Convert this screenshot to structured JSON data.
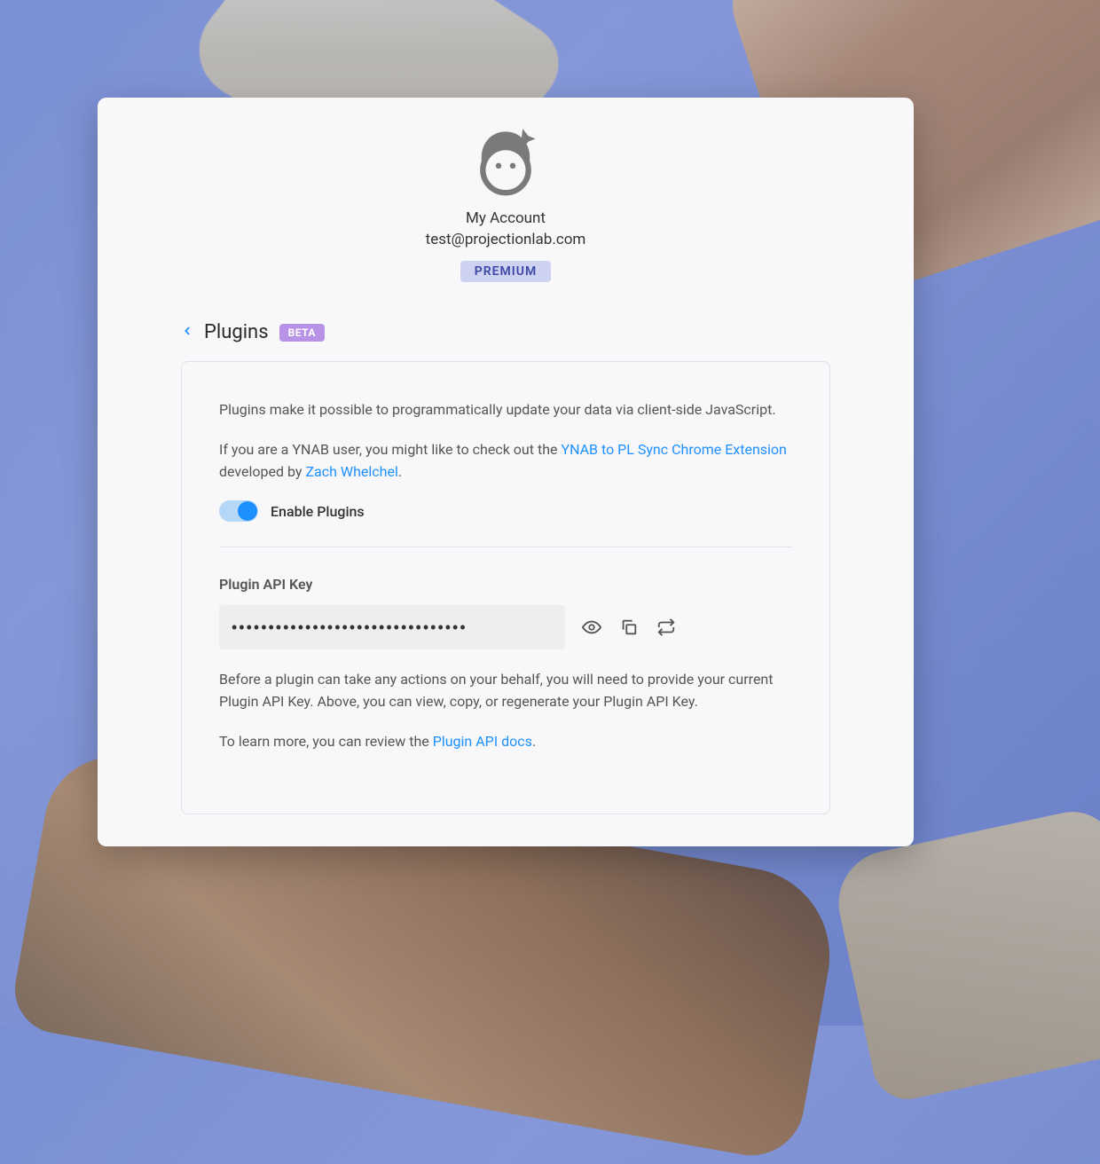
{
  "header": {
    "title": "My Account",
    "email": "test@projectionlab.com",
    "tier_label": "PREMIUM"
  },
  "crumb": {
    "title": "Plugins",
    "badge": "BETA"
  },
  "panel": {
    "intro": "Plugins make it possible to programmatically update your data via client-side JavaScript.",
    "ynab_prefix": "If you are a YNAB user, you might like to check out the ",
    "ynab_link_text": "YNAB to PL Sync Chrome Extension",
    "ynab_mid": " developed by ",
    "ynab_author_link": "Zach Whelchel",
    "ynab_suffix": ".",
    "toggle_label": "Enable Plugins",
    "toggle_enabled": true,
    "api_key_label": "Plugin API Key",
    "api_key_value": "••••••••••••••••••••••••••••••••",
    "help1": "Before a plugin can take any actions on your behalf, you will need to provide your current Plugin API Key. Above, you can view, copy, or regenerate your Plugin API Key.",
    "help2_prefix": "To learn more, you can review the ",
    "help2_link": "Plugin API docs",
    "help2_suffix": "."
  }
}
